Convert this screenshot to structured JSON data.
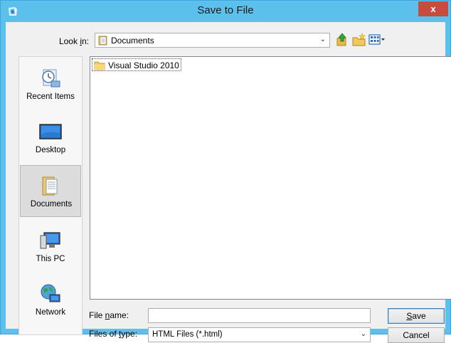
{
  "window": {
    "title": "Save to File",
    "close_label": "x"
  },
  "look_in": {
    "label_pre": "Look ",
    "label_accel": "i",
    "label_post": "n:",
    "value": "Documents"
  },
  "toolbar": {
    "icons": [
      "up-one-level-icon",
      "new-folder-icon",
      "view-menu-icon"
    ]
  },
  "places": [
    {
      "label": "Recent Items",
      "icon": "recent-items-icon",
      "selected": false
    },
    {
      "label": "Desktop",
      "icon": "desktop-icon",
      "selected": false
    },
    {
      "label": "Documents",
      "icon": "documents-icon",
      "selected": true
    },
    {
      "label": "This PC",
      "icon": "this-pc-icon",
      "selected": false
    },
    {
      "label": "Network",
      "icon": "network-icon",
      "selected": false
    }
  ],
  "files": [
    {
      "name": "Visual Studio 2010",
      "icon": "folder-icon"
    }
  ],
  "file_name": {
    "label_pre": "File ",
    "label_accel": "n",
    "label_post": "ame:",
    "value": ""
  },
  "file_type": {
    "label_pre": "Files of ",
    "label_accel": "t",
    "label_post": "ype:",
    "value": "HTML Files (*.html)"
  },
  "buttons": {
    "save_accel": "S",
    "save_rest": "ave",
    "cancel": "Cancel"
  },
  "colors": {
    "titlebar": "#5cc0ec",
    "close": "#c74b3f",
    "dialog_bg": "#f0f0f0"
  }
}
